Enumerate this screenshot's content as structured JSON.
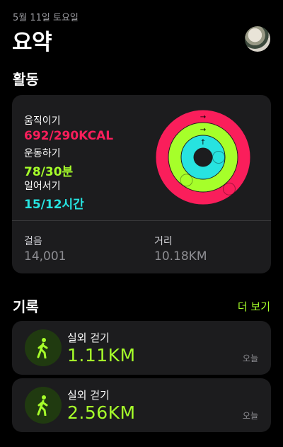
{
  "header": {
    "date": "5월 11일 토요일",
    "title": "요약"
  },
  "activity": {
    "section_title": "활동",
    "move": {
      "label": "움직이기",
      "value": "692/290KCAL",
      "goal_fraction": 2.39,
      "color": "#fa1e5b"
    },
    "exercise": {
      "label": "운동하기",
      "value": "78/30분",
      "goal_fraction": 2.6,
      "color": "#a6ff2a"
    },
    "stand": {
      "label": "일어서기",
      "value": "15/12시간",
      "goal_fraction": 1.25,
      "color": "#27e3e0"
    },
    "steps": {
      "label": "걸음",
      "value": "14,001"
    },
    "distance": {
      "label": "거리",
      "value": "10.18KM"
    }
  },
  "history": {
    "section_title": "기록",
    "see_more": "더 보기",
    "workouts": [
      {
        "type": "실외 걷기",
        "value": "1.11KM",
        "day": "오늘",
        "icon": "walking-figure-icon"
      },
      {
        "type": "실외 걷기",
        "value": "2.56KM",
        "day": "오늘",
        "icon": "walking-figure-icon"
      }
    ]
  }
}
